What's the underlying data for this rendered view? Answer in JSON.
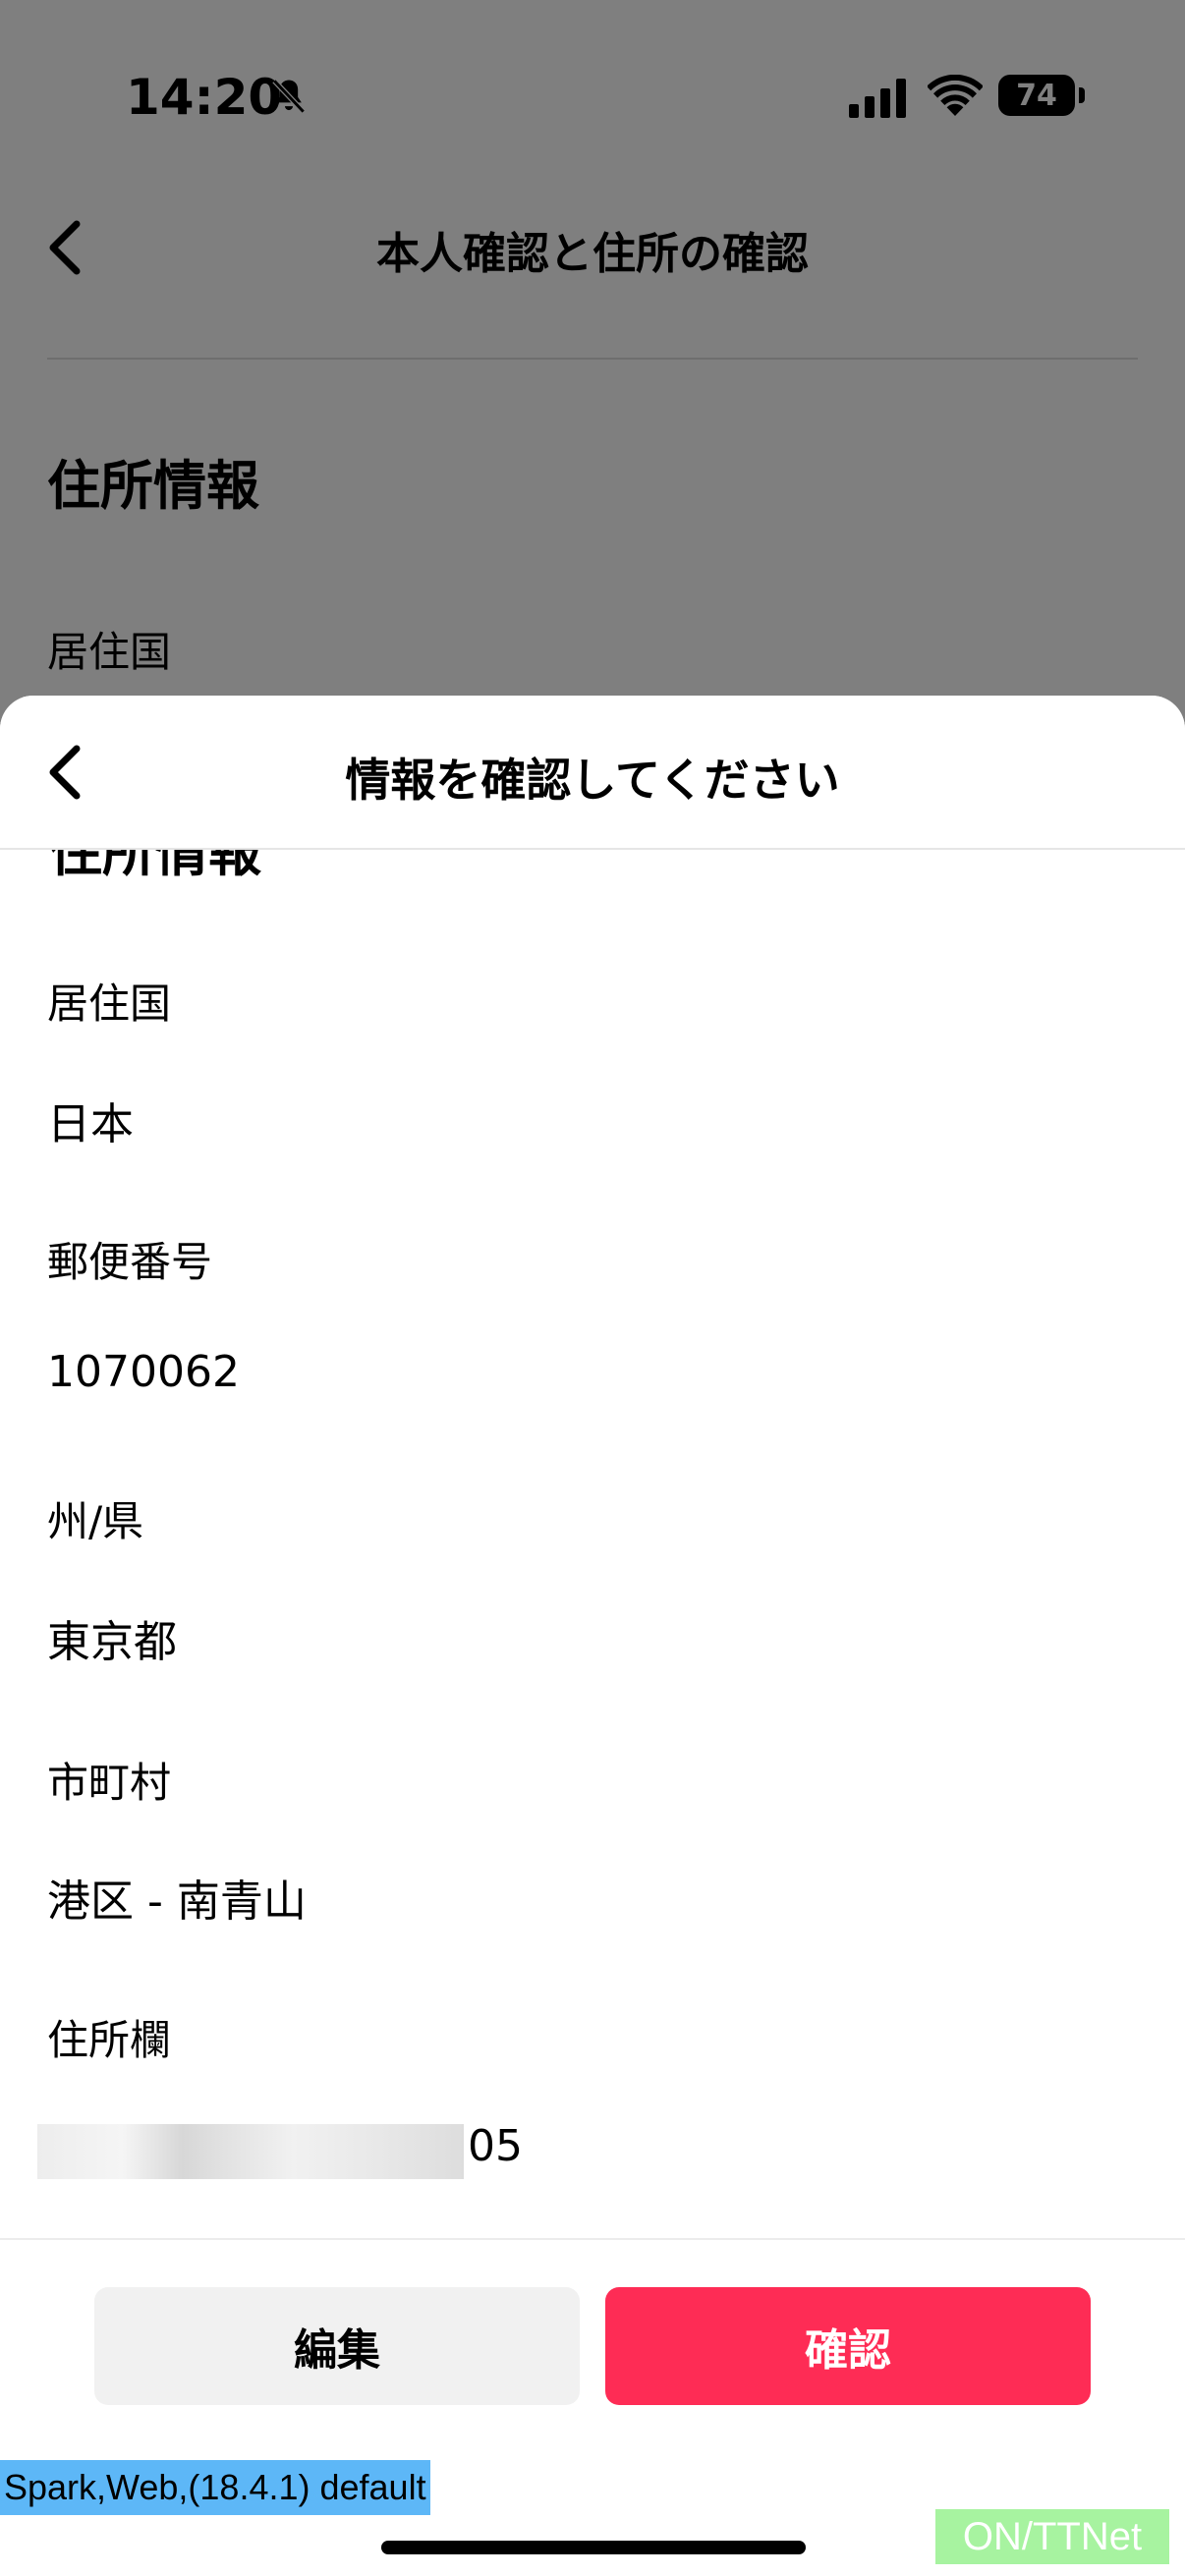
{
  "status_bar": {
    "time": "14:20",
    "battery": "74"
  },
  "background_page": {
    "title": "本人確認と住所の確認",
    "heading": "住所情報",
    "first_label": "居住国"
  },
  "sheet": {
    "title": "情報を確認してください",
    "cut_heading": "住所情報",
    "fields": [
      {
        "label": "居住国",
        "value": "日本"
      },
      {
        "label": "郵便番号",
        "value": "1070062"
      },
      {
        "label": "州/県",
        "value": "東京都"
      },
      {
        "label": "市町村",
        "value": "港区 - 南青山"
      },
      {
        "label": "住所欄",
        "value": "05"
      }
    ],
    "buttons": {
      "edit": "編集",
      "confirm": "確認"
    }
  },
  "debug_label": "Spark,Web,(18.4.1) default",
  "network_label": "ON/TTNet",
  "colors": {
    "accent": "#fe2c55",
    "secondary_button": "#f1f1f1"
  }
}
